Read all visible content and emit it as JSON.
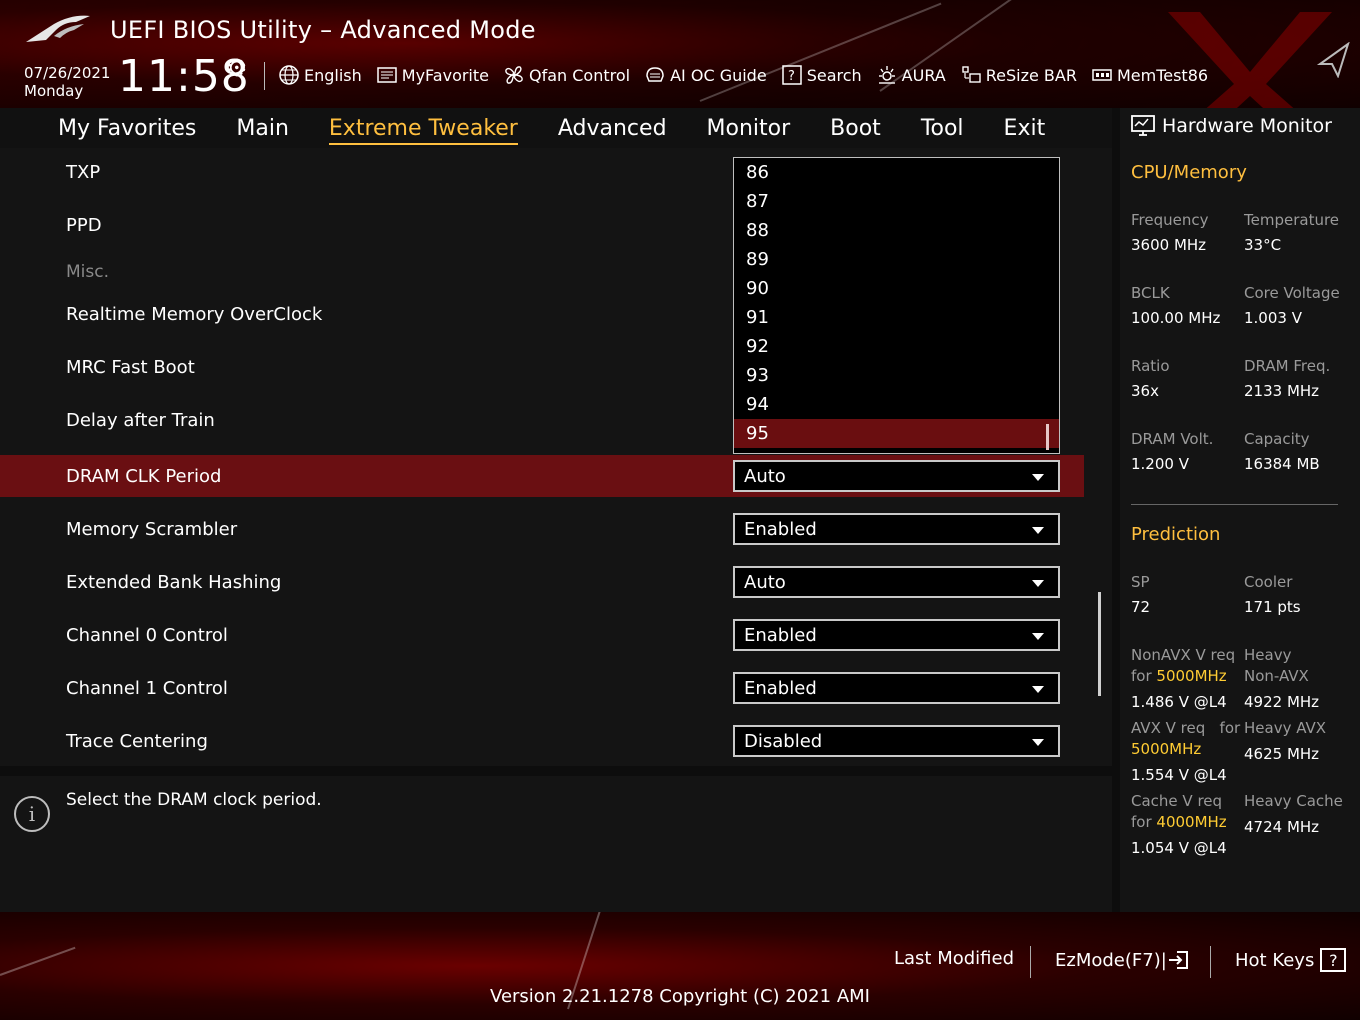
{
  "header": {
    "title": "UEFI BIOS Utility – Advanced Mode",
    "date": "07/26/2021",
    "day": "Monday",
    "time": "11:58",
    "toolbar": [
      {
        "label": "English",
        "icon": "globe-icon"
      },
      {
        "label": "MyFavorite",
        "icon": "favorite-icon"
      },
      {
        "label": "Qfan Control",
        "icon": "fan-icon"
      },
      {
        "label": "AI OC Guide",
        "icon": "ai-oc-guide-icon"
      },
      {
        "label": "Search",
        "icon": "search-icon"
      },
      {
        "label": "AURA",
        "icon": "aura-icon"
      },
      {
        "label": "ReSize BAR",
        "icon": "resize-bar-icon"
      },
      {
        "label": "MemTest86",
        "icon": "memtest-icon"
      }
    ]
  },
  "nav": {
    "tabs": [
      "My Favorites",
      "Main",
      "Extreme Tweaker",
      "Advanced",
      "Monitor",
      "Boot",
      "Tool",
      "Exit"
    ],
    "active": "Extreme Tweaker"
  },
  "settings": {
    "rows": [
      {
        "label": "TXP"
      },
      {
        "label": "PPD"
      },
      {
        "label": "Misc."
      },
      {
        "label": "Realtime Memory OverClock"
      },
      {
        "label": "MRC Fast Boot"
      },
      {
        "label": "Delay after Train"
      },
      {
        "label": "DRAM CLK Period",
        "value": "Auto"
      },
      {
        "label": "Memory Scrambler",
        "value": "Enabled"
      },
      {
        "label": "Extended Bank Hashing",
        "value": "Auto"
      },
      {
        "label": "Channel 0 Control",
        "value": "Enabled"
      },
      {
        "label": "Channel 1 Control",
        "value": "Enabled"
      },
      {
        "label": "Trace Centering",
        "value": "Disabled"
      }
    ],
    "dropdown_options": [
      "86",
      "87",
      "88",
      "89",
      "90",
      "91",
      "92",
      "93",
      "94",
      "95"
    ],
    "dropdown_selected": "95"
  },
  "help": {
    "text": "Select the DRAM clock period."
  },
  "hardware_monitor": {
    "title": "Hardware Monitor",
    "cpu_memory": {
      "section": "CPU/Memory",
      "items": [
        {
          "label": "Frequency",
          "value": "3600 MHz"
        },
        {
          "label": "Temperature",
          "value": "33°C"
        },
        {
          "label": "BCLK",
          "value": "100.00 MHz"
        },
        {
          "label": "Core Voltage",
          "value": "1.003 V"
        },
        {
          "label": "Ratio",
          "value": "36x"
        },
        {
          "label": "DRAM Freq.",
          "value": "2133 MHz"
        },
        {
          "label": "DRAM Volt.",
          "value": "1.200 V"
        },
        {
          "label": "Capacity",
          "value": "16384 MB"
        }
      ]
    },
    "prediction": {
      "section": "Prediction",
      "sp_label": "SP",
      "sp_value": "72",
      "cooler_label": "Cooler",
      "cooler_value": "171 pts",
      "nonavx_label_1": "NonAVX V req",
      "nonavx_label_2": "for",
      "nonavx_freq": "5000MHz",
      "nonavx_value": "1.486 V @L4",
      "heavy_nonavx_label_1": "Heavy",
      "heavy_nonavx_label_2": "Non-AVX",
      "heavy_nonavx_value": "4922 MHz",
      "avx_label_1": "AVX V req",
      "avx_label_2": "for",
      "avx_freq": "5000MHz",
      "avx_value": "1.554 V @L4",
      "heavy_avx_label": "Heavy AVX",
      "heavy_avx_value": "4625 MHz",
      "cache_label_1": "Cache V req",
      "cache_label_2": "for",
      "cache_freq": "4000MHz",
      "cache_value": "1.054 V @L4",
      "heavy_cache_label": "Heavy Cache",
      "heavy_cache_value": "4724 MHz"
    }
  },
  "footer": {
    "last_modified": "Last Modified",
    "ezmode": "EzMode(F7)|",
    "hotkeys": "Hot Keys",
    "hotkeys_box": "?",
    "version": "Version 2.21.1278 Copyright (C) 2021 AMI"
  },
  "colors": {
    "accent": "#ffbf3f",
    "highlight_row": "#6a0f12",
    "brand_red": "#8b0000"
  }
}
